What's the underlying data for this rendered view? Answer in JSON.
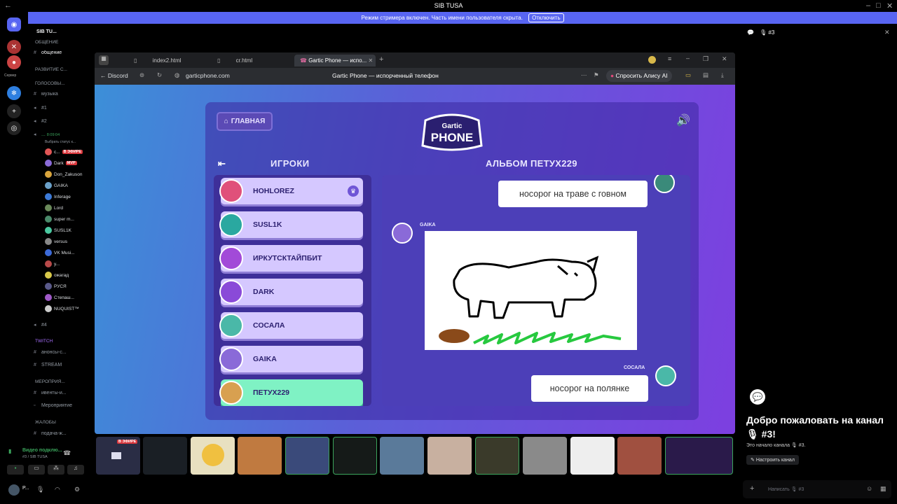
{
  "window": {
    "title": "SIB TUSA"
  },
  "banner": {
    "text": "Режим стримера включен. Часть имени пользователя скрыта.",
    "button": "Отключить"
  },
  "guilds": {
    "servers_label": "Сервер"
  },
  "server": {
    "name": "SIB TU..."
  },
  "channels": {
    "cat_general": "ОБЩЕНИЕ",
    "general": "общение",
    "cat_dev": "РАЗВИТИЕ С...",
    "cat_voice": "ГОЛОСОВЫ...",
    "music": "музыка",
    "v1": "#1",
    "v2": "#2",
    "v3": "...",
    "v3_time": "8:09:04",
    "v3_status": "Выбрать статус к...",
    "v4": "#4",
    "cat_twitch": "TWITCH",
    "announce": "анонсы-с...",
    "stream": "STREAM",
    "cat_events": "МЕРОПРИЯ...",
    "events": "ивенты-и...",
    "events2": "Мероприятие",
    "cat_complaints": "ЖАЛОБЫ",
    "complaint": "подача-ж..."
  },
  "voice_users": [
    {
      "name": "с...",
      "badge": "В ЭФИРЕ",
      "color": "#e25656"
    },
    {
      "name": "Dark",
      "badge": "MVP",
      "color": "#8a6bd8"
    },
    {
      "name": "Don_Zakuson",
      "badge": "",
      "color": "#d8a43c"
    },
    {
      "name": "GAIKA",
      "badge": "",
      "color": "#6aa0c8"
    },
    {
      "name": "Inferage",
      "badge": "",
      "color": "#3c7ad8"
    },
    {
      "name": "Lord",
      "badge": "",
      "color": "#6a8a5a"
    },
    {
      "name": "super m...",
      "badge": "",
      "color": "#4a8a6a"
    },
    {
      "name": "SUSL1K",
      "badge": "",
      "color": "#4ac8a0"
    },
    {
      "name": "versus",
      "badge": "",
      "color": "#888888"
    },
    {
      "name": "VK Musi...",
      "badge": "",
      "color": "#3c6ad8"
    },
    {
      "name": "у...",
      "badge": "",
      "color": "#b84a4a"
    },
    {
      "name": "ожагад",
      "badge": "",
      "color": "#d8c84a"
    },
    {
      "name": "РУСЯ",
      "badge": "",
      "color": "#5a5a8a"
    },
    {
      "name": "Степаш...",
      "badge": "",
      "color": "#a05ac8"
    },
    {
      "name": "NUQUIST™",
      "badge": "",
      "color": "#cccccc"
    }
  ],
  "voice_panel": {
    "status": "Видео подклю...",
    "channel": "#3 / SIB TUSA",
    "user": "P..."
  },
  "browser": {
    "tabs": [
      {
        "label": "index2.html"
      },
      {
        "label": "cr.html"
      },
      {
        "label": "Gartic Phone — испо..."
      }
    ],
    "back_label": "Discord",
    "url": "garticphone.com",
    "page_title": "Gartic Phone — испорченный телефон",
    "alice": "Спросить Алису AI"
  },
  "game": {
    "home": "ГЛАВНАЯ",
    "logo_top": "Gartic",
    "logo_bottom": "PHONE",
    "players_title": "ИГРОКИ",
    "album_title": "АЛЬБОМ ПЕТУХ229",
    "players": [
      {
        "name": "HOHLOREZ",
        "host": true,
        "color": "#e0507a"
      },
      {
        "name": "SUSL1K",
        "host": false,
        "color": "#2aa8a0"
      },
      {
        "name": "ИРКУТСКТАЙПБИТ",
        "host": false,
        "color": "#a24ad8"
      },
      {
        "name": "DARK",
        "host": false,
        "color": "#8a4ad8"
      },
      {
        "name": "СОСАЛА",
        "host": false,
        "color": "#4ab8a8"
      },
      {
        "name": "GAIKA",
        "host": false,
        "color": "#8a6ad8"
      },
      {
        "name": "ПЕТУХ229",
        "host": false,
        "color": "#d8a050",
        "active": true
      }
    ],
    "album": [
      {
        "author": "",
        "text": "носорог на траве с говном"
      },
      {
        "author": "GAIKA",
        "text": ""
      },
      {
        "author": "СОСАЛА",
        "text": "носорог на полянке"
      }
    ]
  },
  "right_panel": {
    "channel": "#3",
    "welcome": "Добро пожаловать на канал 🎙 #3!",
    "sub": "Это начало канала 🎙 #3.",
    "settings": "Настроить канал",
    "input_placeholder": "Написать 🎙 #3"
  },
  "stream_strip": {
    "live_badge": "В ЭФИРЕ"
  }
}
